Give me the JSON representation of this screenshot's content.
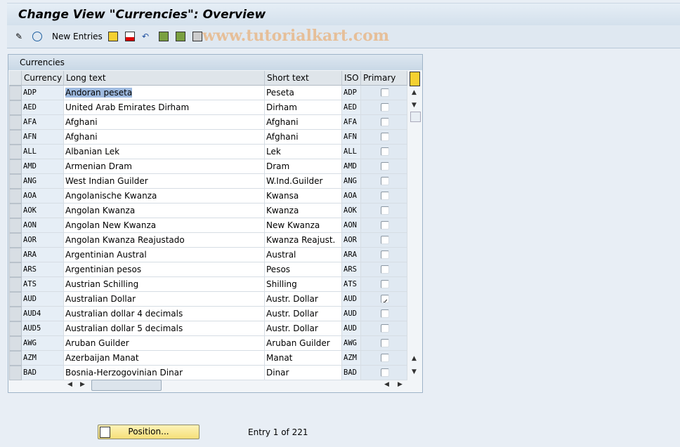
{
  "title": "Change View \"Currencies\": Overview",
  "toolbar": {
    "new_entries": "New Entries",
    "watermark": "www.tutorialkart.com"
  },
  "table": {
    "caption": "Currencies",
    "columns": [
      "Currency",
      "Long text",
      "Short text",
      "ISO",
      "Primary"
    ],
    "rows": [
      [
        "ADP",
        "Andoran peseta",
        "Peseta",
        "ADP",
        false
      ],
      [
        "AED",
        "United Arab Emirates Dirham",
        "Dirham",
        "AED",
        false
      ],
      [
        "AFA",
        "Afghani",
        "Afghani",
        "AFA",
        false
      ],
      [
        "AFN",
        "Afghani",
        "Afghani",
        "AFN",
        false
      ],
      [
        "ALL",
        "Albanian Lek",
        "Lek",
        "ALL",
        false
      ],
      [
        "AMD",
        "Armenian Dram",
        "Dram",
        "AMD",
        false
      ],
      [
        "ANG",
        "West Indian Guilder",
        "W.Ind.Guilder",
        "ANG",
        false
      ],
      [
        "AOA",
        "Angolanische Kwanza",
        "Kwansa",
        "AOA",
        false
      ],
      [
        "AOK",
        "Angolan Kwanza",
        "Kwanza",
        "AOK",
        false
      ],
      [
        "AON",
        "Angolan New Kwanza",
        "New Kwanza",
        "AON",
        false
      ],
      [
        "AOR",
        "Angolan Kwanza Reajustado",
        "Kwanza Reajust.",
        "AOR",
        false
      ],
      [
        "ARA",
        "Argentinian Austral",
        "Austral",
        "ARA",
        false
      ],
      [
        "ARS",
        "Argentinian pesos",
        "Pesos",
        "ARS",
        false
      ],
      [
        "ATS",
        "Austrian Schilling",
        "Shilling",
        "ATS",
        false
      ],
      [
        "AUD",
        "Australian Dollar",
        "Austr. Dollar",
        "AUD",
        true
      ],
      [
        "AUD4",
        "Australian dollar 4 decimals",
        "Austr. Dollar",
        "AUD",
        false
      ],
      [
        "AUD5",
        "Australian dollar 5 decimals",
        "Austr. Dollar",
        "AUD",
        false
      ],
      [
        "AWG",
        "Aruban Guilder",
        "Aruban Guilder",
        "AWG",
        false
      ],
      [
        "AZM",
        "Azerbaijan Manat",
        "Manat",
        "AZM",
        false
      ],
      [
        "BAD",
        "Bosnia-Herzogovinian Dinar",
        "Dinar",
        "BAD",
        false
      ]
    ]
  },
  "footer": {
    "position_button": "Position...",
    "entry_text": "Entry 1 of 221"
  }
}
